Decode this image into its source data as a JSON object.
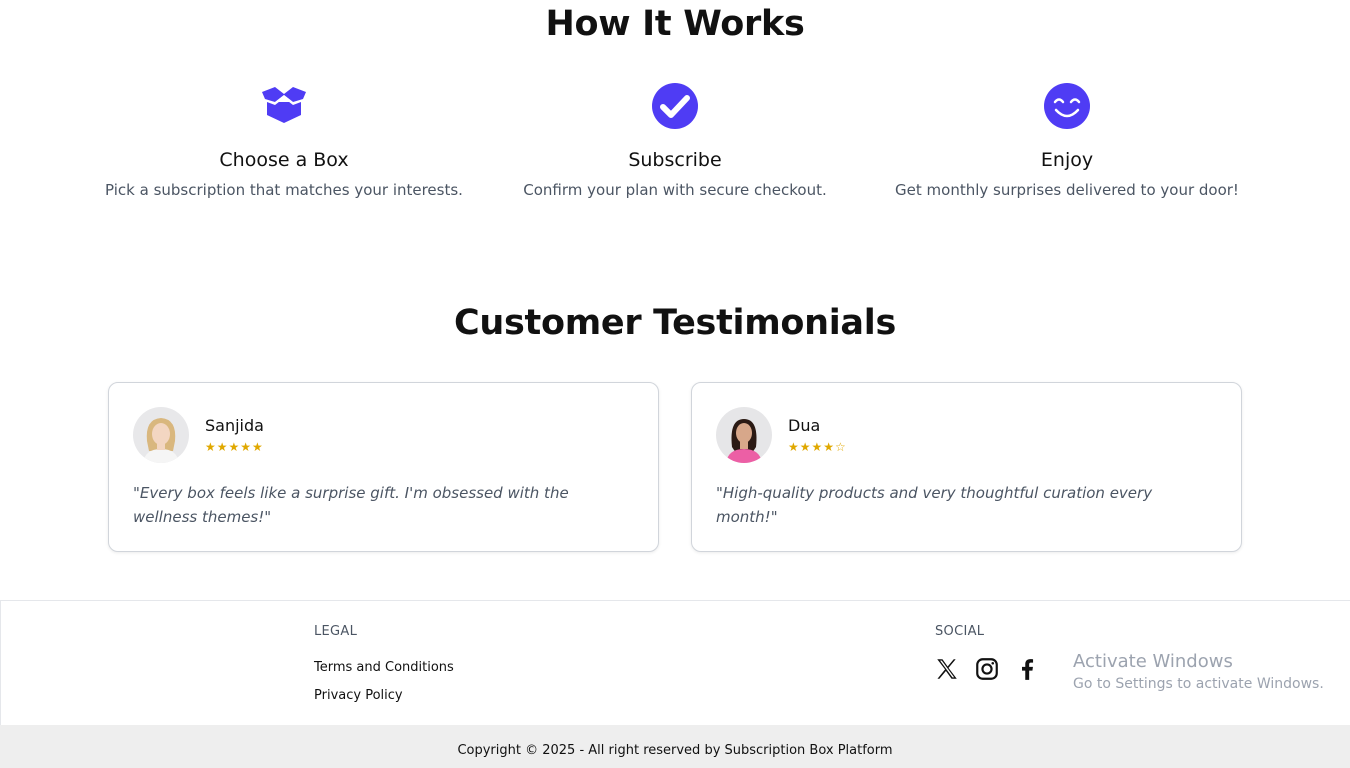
{
  "how_it_works": {
    "title": "How It Works",
    "steps": [
      {
        "icon": "box-open-icon",
        "title": "Choose a Box",
        "description": "Pick a subscription that matches your interests."
      },
      {
        "icon": "check-circle-icon",
        "title": "Subscribe",
        "description": "Confirm your plan with secure checkout."
      },
      {
        "icon": "smile-icon",
        "title": "Enjoy",
        "description": "Get monthly surprises delivered to your door!"
      }
    ],
    "accent_color": "#4f3cf4"
  },
  "testimonials": {
    "title": "Customer Testimonials",
    "items": [
      {
        "name": "Sanjida",
        "stars": "★★★★★",
        "rating": 5,
        "quote": "\"Every box feels like a surprise gift. I'm obsessed with the wellness themes!\""
      },
      {
        "name": "Dua",
        "stars": "★★★★☆",
        "rating": 4,
        "quote": "\"High-quality products and very thoughtful curation every month!\""
      }
    ],
    "star_color": "#e0a800"
  },
  "footer": {
    "legal": {
      "heading": "LEGAL",
      "links": [
        "Terms and Conditions",
        "Privacy Policy"
      ]
    },
    "social": {
      "heading": "SOCIAL",
      "icons": [
        "x-twitter-icon",
        "instagram-icon",
        "facebook-icon"
      ]
    },
    "copyright": "Copyright © 2025 - All right reserved by Subscription Box Platform"
  },
  "watermark": {
    "line1": "Activate Windows",
    "line2": "Go to Settings to activate Windows."
  }
}
